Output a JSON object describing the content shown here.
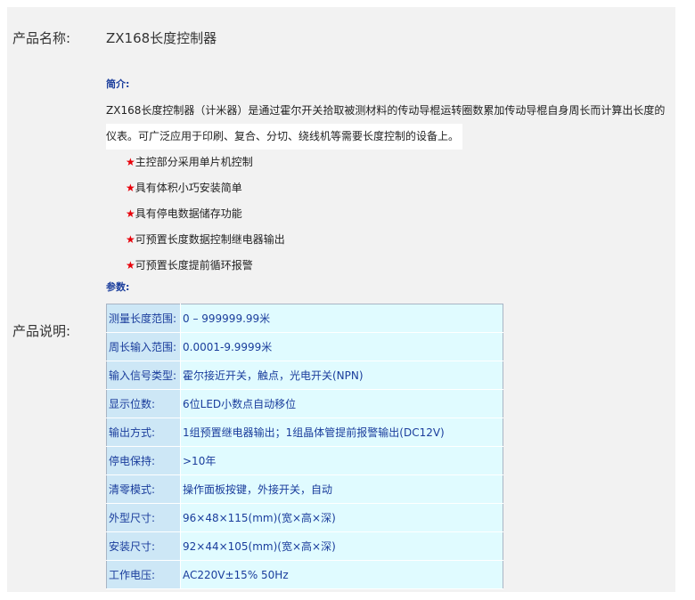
{
  "labels": {
    "product_name": "产品名称:",
    "product_desc": "产品说明:"
  },
  "product": {
    "name": "ZX168长度控制器"
  },
  "description": {
    "intro_title": "简介:",
    "intro_line1": "ZX168长度控制器（计米器）是通过霍尔开关拾取被测材料的传动导棍运转圈数累加传动导棍自身周长而计算出长度的",
    "intro_line2": "仪表。可广泛应用于印刷、复合、分切、绕线机等需要长度控制的设备上。",
    "star": "★",
    "features": [
      "主控部分采用单片机控制",
      "具有体积小巧安装简单",
      "具有停电数据储存功能",
      "可预置长度数据控制继电器输出",
      "可预置长度提前循环报警"
    ],
    "params_title": "参数:",
    "params": [
      {
        "key": "测量长度范围:",
        "value": "0 – 999999.99米"
      },
      {
        "key": "周长输入范围:",
        "value": "0.0001-9.9999米"
      },
      {
        "key": "输入信号类型:",
        "value": "霍尔接近开关，触点，光电开关(NPN)"
      },
      {
        "key": "显示位数:",
        "value": "6位LED小数点自动移位"
      },
      {
        "key": "输出方式:",
        "value": "1组预置继电器输出；1组晶体管提前报警输出(DC12V)"
      },
      {
        "key": "停电保持:",
        "value": ">10年"
      },
      {
        "key": "清零模式:",
        "value": "操作面板按键，外接开关，自动"
      },
      {
        "key": "外型尺寸:",
        "value": "96×48×115(mm)(宽×高×深)"
      },
      {
        "key": "安装尺寸:",
        "value": "92×44×105(mm)(宽×高×深)"
      },
      {
        "key": "工作电压:",
        "value": "AC220V±15% 50Hz"
      }
    ]
  },
  "colors": {
    "panel_bg": "#f2f2f2",
    "title_blue": "#1a3d9c",
    "star_red": "#e8000a",
    "key_cell_bg": "#cde7f6",
    "value_cell_bg": "#e0fbff"
  }
}
